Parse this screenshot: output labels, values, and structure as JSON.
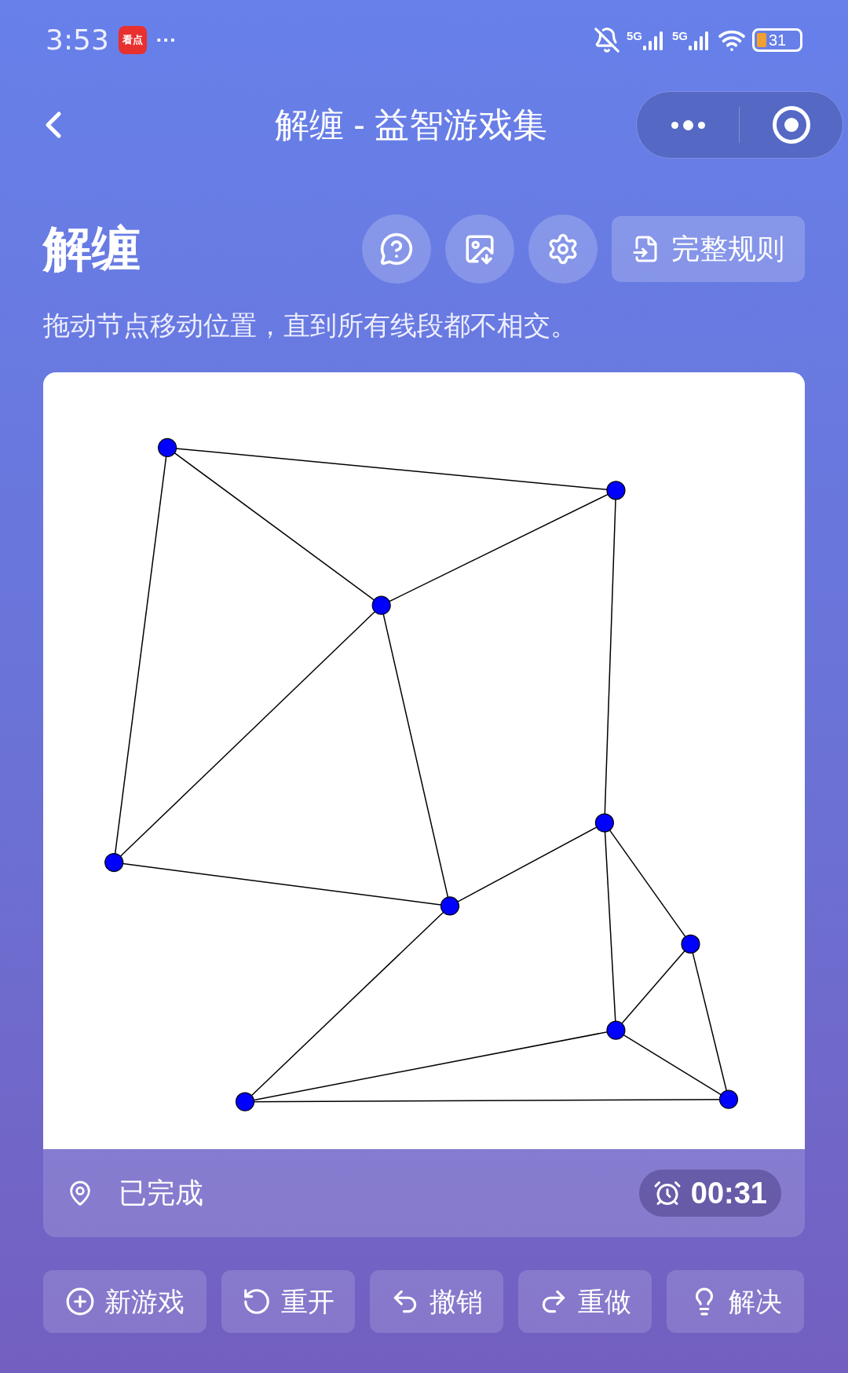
{
  "status_bar": {
    "time": "3:53",
    "app_badge": "看点",
    "more": "···",
    "networks": [
      "5G",
      "5G"
    ],
    "battery": "31"
  },
  "nav": {
    "title": "解缠 - 益智游戏集"
  },
  "header": {
    "title": "解缠",
    "rules_button": "完整规则",
    "description": "拖动节点移动位置，直到所有线段都不相交。"
  },
  "status": {
    "text": "已完成",
    "timer": "00:31"
  },
  "buttons": [
    {
      "label": "新游戏",
      "kind": "new"
    },
    {
      "label": "重开",
      "kind": "restart"
    },
    {
      "label": "撤销",
      "kind": "undo"
    },
    {
      "label": "重做",
      "kind": "redo"
    },
    {
      "label": "解决",
      "kind": "solve"
    }
  ]
}
